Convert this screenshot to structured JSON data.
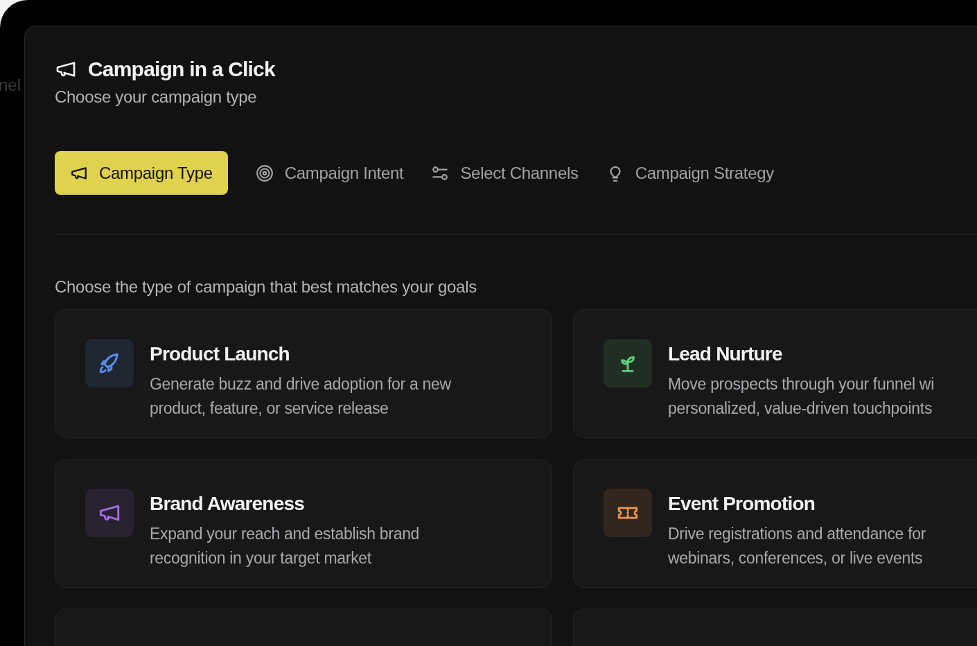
{
  "background_text": "nel",
  "header": {
    "title": "Campaign in a Click",
    "subtitle": "Choose your campaign type"
  },
  "tabs": [
    {
      "label": "Campaign Type",
      "kind": "megaphone",
      "selected": true
    },
    {
      "label": "Campaign Intent",
      "kind": "target",
      "selected": false
    },
    {
      "label": "Select Channels",
      "kind": "sliders",
      "selected": false
    },
    {
      "label": "Campaign Strategy",
      "kind": "bulb",
      "selected": false
    }
  ],
  "prompt": "Choose the type of campaign that best matches your goals",
  "cards": [
    {
      "title": "Product Launch",
      "kind": "rocket",
      "color": "#5b8def",
      "description": [
        "Generate buzz and drive adoption for a new",
        "product, feature, or service release"
      ]
    },
    {
      "title": "Lead Nurture",
      "kind": "sprout",
      "color": "#5ccf7a",
      "description": [
        "Move prospects through your funnel wi",
        "personalized, value-driven touchpoints"
      ]
    },
    {
      "title": "Brand Awareness",
      "kind": "megaphone",
      "color": "#a66ee8",
      "description": [
        "Expand your reach and establish brand",
        "recognition in your target market"
      ]
    },
    {
      "title": "Event Promotion",
      "kind": "ticket",
      "color": "#f0954a",
      "description": [
        "Drive registrations and attendance for",
        "webinars, conferences, or live events"
      ]
    }
  ]
}
